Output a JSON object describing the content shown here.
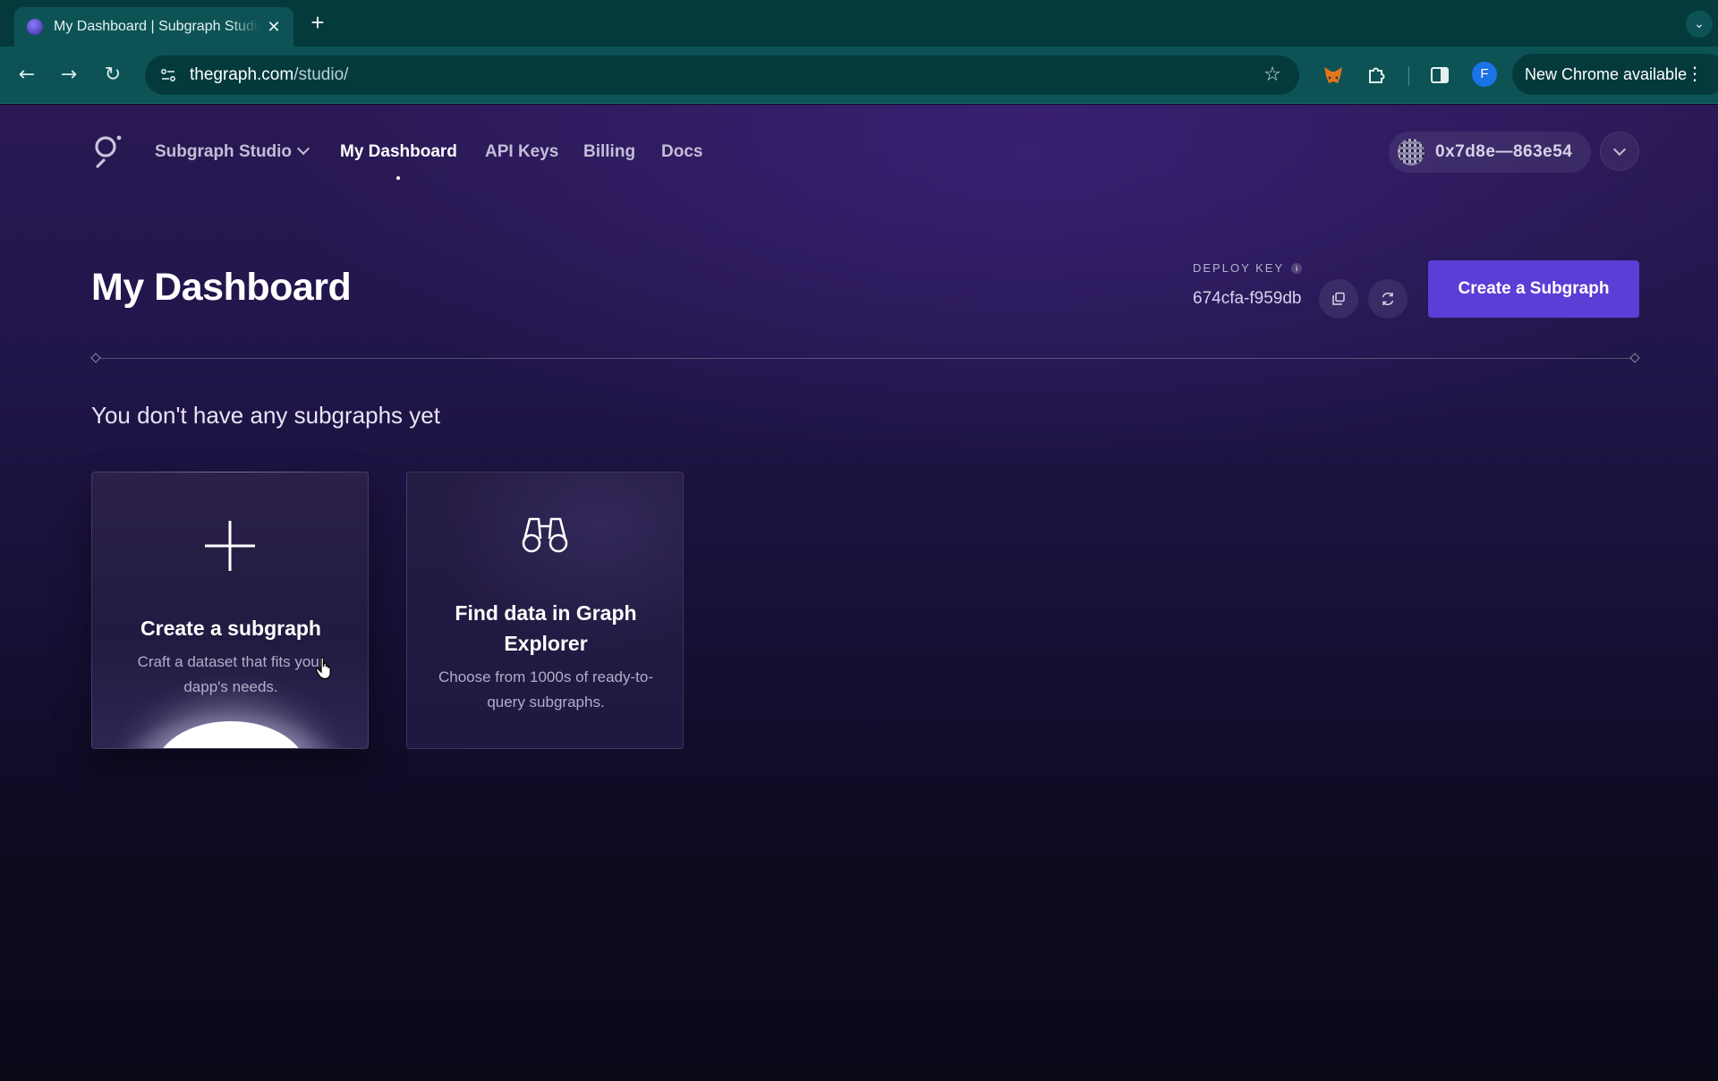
{
  "browser": {
    "tab_title": "My Dashboard | Subgraph Studio",
    "tab_close": "✕",
    "new_tab": "+",
    "url_host": "thegraph.com",
    "url_path": "/studio/",
    "update_label": "New Chrome available",
    "profile_initial": "F"
  },
  "nav": {
    "studio_label": "Subgraph Studio",
    "dashboard_label": "My Dashboard",
    "api_keys_label": "API Keys",
    "billing_label": "Billing",
    "docs_label": "Docs",
    "wallet_address": "0x7d8e—863e54"
  },
  "header": {
    "title": "My Dashboard",
    "deploy_key_label": "DEPLOY KEY",
    "deploy_key_value": "674cfa-f959db",
    "create_button": "Create a Subgraph"
  },
  "main": {
    "empty_message": "You don't have any subgraphs yet",
    "cards": [
      {
        "title": "Create a subgraph",
        "description": "Craft a dataset that fits your dapp's needs."
      },
      {
        "title": "Find data in Graph Explorer",
        "description": "Choose from 1000s of ready-to-query subgraphs."
      }
    ]
  },
  "icons": {
    "logo": "the-graph-logo",
    "plus": "plus-icon",
    "binoculars": "binoculars-icon",
    "copy": "copy-icon",
    "refresh": "refresh-icon"
  },
  "colors": {
    "accent": "#5b3ed6",
    "browser_frame": "#0d5356",
    "page_top": "#2a1854",
    "page_bottom": "#0a0918"
  }
}
